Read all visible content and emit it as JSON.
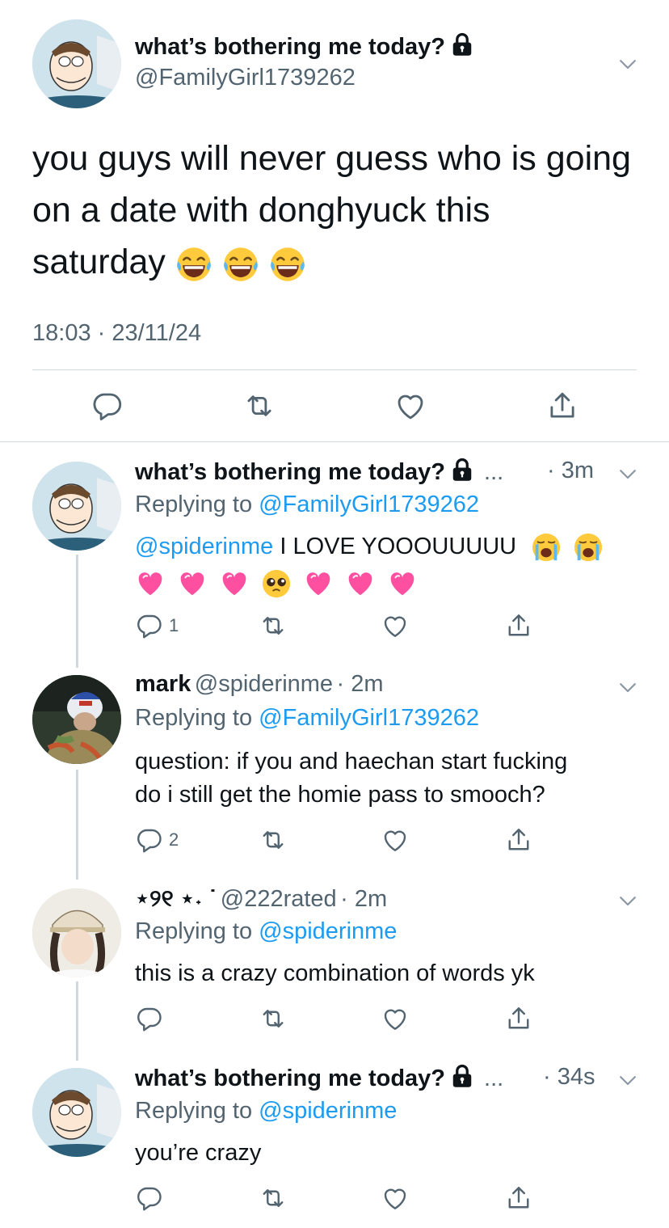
{
  "colors": {
    "link": "#1d9bf0",
    "secondary": "#536471",
    "divider": "#cfd9de"
  },
  "main_tweet": {
    "display_name": "what’s bothering me today?",
    "handle": "@FamilyGirl1739262",
    "text_line1": "you guys will never guess who is going",
    "text_line2": "on a date with donghyuck this",
    "text_line3": "saturday",
    "emojis": [
      "face-with-tears-of-joy",
      "face-with-tears-of-joy",
      "face-with-tears-of-joy"
    ],
    "timestamp": "18:03 · 23/11/24",
    "actions": [
      "reply-icon",
      "retweet-icon",
      "like-icon",
      "share-icon"
    ]
  },
  "replies": [
    {
      "display_name": "what’s bothering me today?",
      "dots": "...",
      "time": "· 3m",
      "replying_prefix": "Replying to ",
      "replying_to": "@FamilyGirl1739262",
      "mention": "@spiderinme",
      "text": " I LOVE YOOOUUUUU",
      "emojis_line1": [
        "loudly-crying-face",
        "loudly-crying-face"
      ],
      "emojis_line2": [
        "sparkling-heart",
        "two-hearts",
        "revolving-hearts",
        "pleading-face",
        "growing-heart",
        "two-hearts",
        "heart-with-arrow"
      ],
      "reply_count": "1"
    },
    {
      "display_name": "mark",
      "handle": "@spiderinme",
      "time": "· 2m",
      "replying_prefix": "Replying to ",
      "replying_to": "@FamilyGirl1739262",
      "text_line1": "question: if you and haechan start fucking",
      "text_line2": "do i still get the homie pass to smooch?",
      "reply_count": "2"
    },
    {
      "display_name": "⋆୨୧ ⋆˖ ˙",
      "handle": "@222rated",
      "time": "· 2m",
      "replying_prefix": "Replying to ",
      "replying_to": "@spiderinme",
      "text": "this is a crazy combination of words yk"
    },
    {
      "display_name": "what’s bothering me today?",
      "dots": "...",
      "time": "· 34s",
      "replying_prefix": "Replying to ",
      "replying_to": "@spiderinme",
      "text": "you’re crazy"
    }
  ]
}
